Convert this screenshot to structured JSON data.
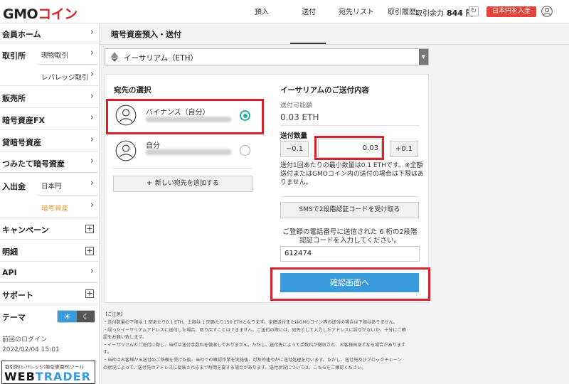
{
  "header": {
    "logo_main": "GMO",
    "logo_accent": "コイン",
    "balance_label": "取引余力",
    "balance_value": "844 円",
    "deposit_button": "日本円を入金"
  },
  "sidebar": {
    "home": "会員ホーム",
    "exchange": "取引所",
    "exchange_spot": "現物取引",
    "exchange_leverage": "レバレッジ取引",
    "store": "販売所",
    "crypto_fx": "暗号資産FX",
    "lending": "貸暗号資産",
    "tsumitate": "つみたて暗号資産",
    "deposit_withdraw": "入出金",
    "deposit_jpy": "日本円",
    "deposit_crypto": "暗号資産",
    "campaign": "キャンペーン",
    "statements": "明細",
    "api": "API",
    "support": "サポート",
    "theme": "テーマ",
    "last_login_label": "前回のログイン",
    "last_login_value": "2022/02/04 15:01",
    "webtrader_caption": "取引所(レバレッジ)取引専用PCツール",
    "webtrader_main": "WEB",
    "webtrader_accent": "TRADER"
  },
  "main": {
    "title": "暗号資産預入・送付",
    "tabs": [
      "預入",
      "送付",
      "宛先リスト",
      "取引履歴"
    ],
    "active_tab": "送付",
    "currency": "イーサリアム（ETH）",
    "destination": {
      "title": "宛先の選択",
      "items": [
        {
          "name": "バイナンス（自分）",
          "selected": true
        },
        {
          "name": "自分",
          "selected": false
        }
      ],
      "add_button": "新しい宛先を追加する"
    },
    "send": {
      "title": "イーサリアムのご送付内容",
      "available_label": "送付可能額",
      "available_value": "0.03 ETH",
      "quantity_label": "送付数量",
      "minus_button": "−0.1",
      "quantity_value": "0.03",
      "plus_button": "+0.1",
      "note": "送付1回あたりの最小数量は0.1 ETHです。※全額送付またはGMOコイン内の送付の場合は下限はありません。",
      "sms_button": "SMSで2段階認証コードを受け取る",
      "sms_desc": "ご登録の電話番号に送信された 6 桁の2段階認証コードを入力してください。",
      "code_value": "612474",
      "confirm_button": "確認画面へ"
    }
  },
  "notes": {
    "header": "【ご注意】",
    "lines": [
      "・送付数量の下限は 1 回あたり0.1 ETH、上限は 1 回あたり150 ETHとなります。全額送付またはGMOコイン内の送付の場合は下限はありません。",
      "・誤ったイーサリアムアドレスに送付した場合、取り戻すことはできません。ご送付の際には、宛先として入力したアドレスに誤りがないか、十分にご確",
      "  認をお願い致します。",
      "・イーサリアムのご送付に際し、当社は送付手数料を徴収しておりません。ただし、送付先によって手数料が徴収され、お客様自身となる場合があります",
      "  す。",
      "・当社はお客様から送付のご依頼を受けた後、当社での確認作業を実施後、可及的速やかに送付処理を行います。ただし、送付先及びブロックチェーン",
      "  の状況によって、送付先のアドレスに反映されるまで時間を要する場合があります。送付状況については、こちらをご確認ください。"
    ]
  },
  "colors": {
    "brand_red": "#d8262a",
    "primary_blue": "#3a9bdc",
    "radio_teal": "#27b0a4",
    "active_orange": "#e8963b"
  }
}
